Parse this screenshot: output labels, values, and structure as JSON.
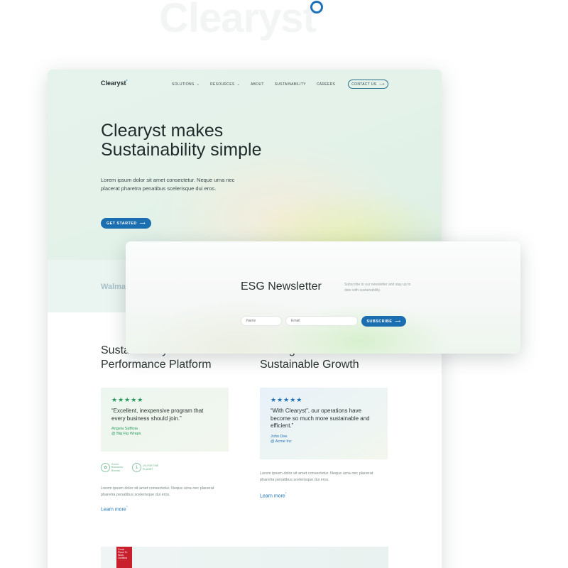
{
  "watermark": {
    "text": "Clearyst"
  },
  "nav": {
    "logo": "Clearyst",
    "logo_mark": "°",
    "links": [
      {
        "label": "SOLUTIONS",
        "chevron": "⌄"
      },
      {
        "label": "RESOURCES",
        "chevron": "⌄"
      },
      {
        "label": "ABOUT"
      },
      {
        "label": "SUSTAINABILITY"
      },
      {
        "label": "CAREERS"
      }
    ],
    "contact_label": "CONTACT US",
    "arrow": "⟶"
  },
  "hero": {
    "title_line1": "Clearyst makes",
    "title_line2": "Sustainability simple",
    "body": "Lorem ipsum dolor sit amet consectetur. Neque urna nec placerat pharetra penatibus scelerisque dui eros.",
    "cta_label": "GET STARTED"
  },
  "logos": {
    "walmart": "Walma"
  },
  "section_left": {
    "title_line1": "Sustainability",
    "title_line2": "Performance Platform",
    "stars": "★★★★★",
    "quote": "“Excellent, inexpensive program that every business should join.”",
    "author": "Angela Saffioia",
    "company": "@ Big Fig Wraps",
    "badge1": "Green Business Bureau",
    "badge2": "1% FOR THE PLANET",
    "body": "Lorem ipsum dolor sit amet consectetur. Neque urna nec placerat pharetra penatibus scelerisque dui eros.",
    "learn_more": "Learn more",
    "learn_mark": "°"
  },
  "section_right": {
    "title_line1": "Driving",
    "title_line2": "Sustainable Growth",
    "stars": "★★★★★",
    "quote": "“With Clearyst”, our operations have become so much more sustainable and efficient.”",
    "author": "John Doe",
    "company": "@ Acme Inc",
    "body": "Lorem ipsum dolor sit amet consectetur. Neque urna nec placerat pharetra penatibus scelerisque dui eros.",
    "learn_more": "Learn more",
    "learn_mark": "°"
  },
  "gptw": {
    "text": "Great Place To Work. Certified"
  },
  "newsletter": {
    "title": "ESG Newsletter",
    "description": "Subscribe to our newsletter and stay up to date with sustainability.",
    "name_placeholder": "Name",
    "email_placeholder": "Email",
    "subscribe_label": "SUBSCRIBE"
  }
}
